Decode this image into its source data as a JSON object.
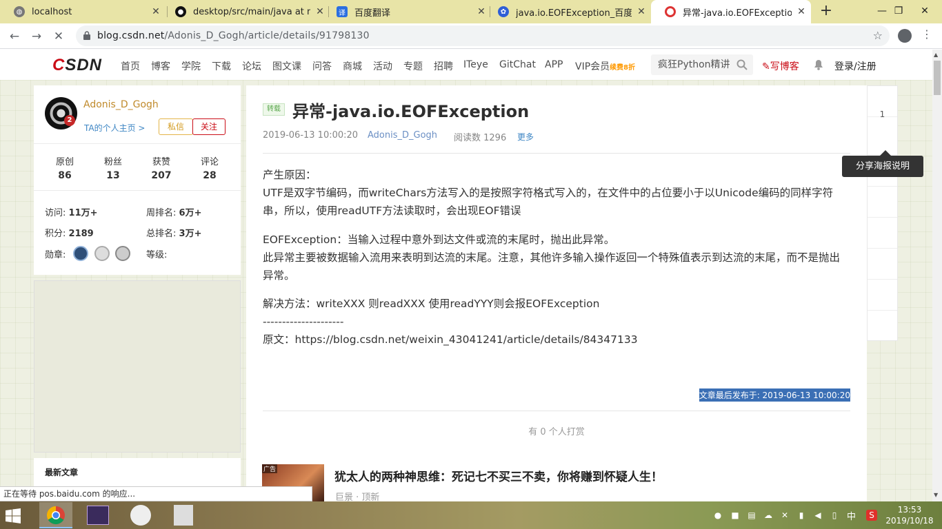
{
  "browser": {
    "tabs": [
      {
        "title": "localhost",
        "icon": "globe-icon",
        "active": false
      },
      {
        "title": "desktop/src/main/java at ma",
        "icon": "github-icon",
        "active": false
      },
      {
        "title": "百度翻译",
        "icon": "baidu-translate-icon",
        "active": false
      },
      {
        "title": "java.io.EOFException_百度搜索",
        "icon": "baidu-paw-icon",
        "active": false
      },
      {
        "title": "异常-java.io.EOFException - A",
        "icon": "csdn-icon",
        "active": true
      }
    ],
    "new_tab_label": "+",
    "url_host": "blog.csdn.net",
    "url_path": "/Adonis_D_Gogh/article/details/91798130",
    "status_text": "正在等待 pos.baidu.com 的响应..."
  },
  "csdn_header": {
    "logo_c": "C",
    "logo_rest": "SDN",
    "nav": [
      "首页",
      "博客",
      "学院",
      "下载",
      "论坛",
      "图文课",
      "问答",
      "商城",
      "活动",
      "专题",
      "招聘",
      "ITeye",
      "GitChat",
      "APP"
    ],
    "vip_label": "VIP会员",
    "vip_sub": "续费8折",
    "search_placeholder": "疯狂Python精讲",
    "write_blog": "写博客",
    "login": "登录/注册"
  },
  "profile": {
    "name": "Adonis_D_Gogh",
    "avatar_badge": "2",
    "home_link": "TA的个人主页 >",
    "message_button": "私信",
    "follow_button": "关注",
    "stats": [
      {
        "label": "原创",
        "value": "86"
      },
      {
        "label": "粉丝",
        "value": "13"
      },
      {
        "label": "获赞",
        "value": "207"
      },
      {
        "label": "评论",
        "value": "28"
      }
    ],
    "visits_label": "访问:",
    "visits_value": "11万+",
    "week_rank_label": "周排名:",
    "week_rank_value": "6万+",
    "points_label": "积分:",
    "points_value": "2189",
    "total_rank_label": "总排名:",
    "total_rank_value": "3万+",
    "medals_label": "勋章:",
    "level_label": "等级:"
  },
  "latest_articles_title": "最新文章",
  "article": {
    "tag": "转载",
    "title": "异常-java.io.EOFException",
    "date": "2019-06-13 10:00:20",
    "author": "Adonis_D_Gogh",
    "read_count": "阅读数 1296",
    "more": "更多",
    "cause_heading": "产生原因：",
    "cause_text": "UTF是双字节编码，而writeChars方法写入的是按照字符格式写入的，在文件中的占位要小于以Unicode编码的同样字符串，所以，使用readUTF方法读取时，会出现EOF错误",
    "eof_line1": "EOFException：当输入过程中意外到达文件或流的末尾时，抛出此异常。",
    "eof_line2": "此异常主要被数据输入流用来表明到达流的末尾。注意，其他许多输入操作返回一个特殊值表示到达流的末尾，而不是抛出异常。",
    "solution": "解决方法：writeXXX 则readXXX 使用readYYY则会报EOFException",
    "separator": "---------------------",
    "source": "原文：https://blog.csdn.net/weixin_43041241/article/details/84347133",
    "published": "文章最后发布于: 2019-06-13 10:00:20",
    "reward": "有 0 个人打赏"
  },
  "ad": {
    "tag": "广告",
    "title": "犹太人的两种神思维：死记七不买三不卖，你将赚到怀疑人生！",
    "source": "巨景 · 顶新"
  },
  "toolbox": {
    "like_count": "1",
    "tooltip": "分享海报说明"
  },
  "taskbar": {
    "ime": "中",
    "time": "13:53",
    "date": "2019/10/18"
  }
}
